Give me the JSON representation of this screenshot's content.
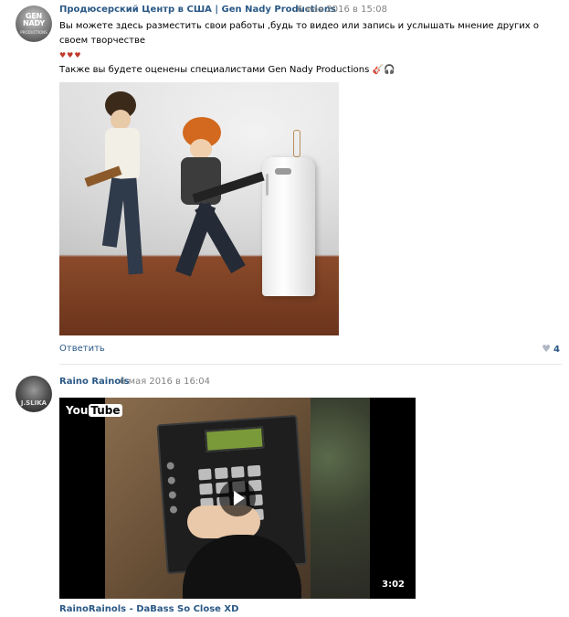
{
  "post1": {
    "author": "Продюсерский Центр в США | Gen Nady Productions",
    "date": "6 мая 2016 в 15:08",
    "text_line1": "Вы можете здесь разместить свои работы ,будь то видео или запись и услышать мнение других о своем творчестве",
    "hearts": "♥♥♥",
    "text_line3": "Также вы будете оценены специалистами Gen Nady Productions",
    "emoji": "🎸🎧",
    "reply_label": "Ответить",
    "likes_count": "4",
    "avatar_text": "GEN NADY",
    "avatar_sub": "PRODUCTIONS"
  },
  "post2": {
    "author": "Raino Rainols",
    "date": "6 мая 2016 в 16:04",
    "avatar_text": "J.SLIKA",
    "video": {
      "logo_you": "You",
      "logo_tube": "Tube",
      "duration": "3:02",
      "title": "RainoRainols - DaBass So Close XD"
    }
  },
  "colors": {
    "link": "#2a5885",
    "meta": "#828282",
    "divider": "#e7e8ec",
    "like_icon": "#b0b8c5"
  },
  "icons": [
    "heart-icon",
    "play-icon",
    "youtube-logo"
  ]
}
